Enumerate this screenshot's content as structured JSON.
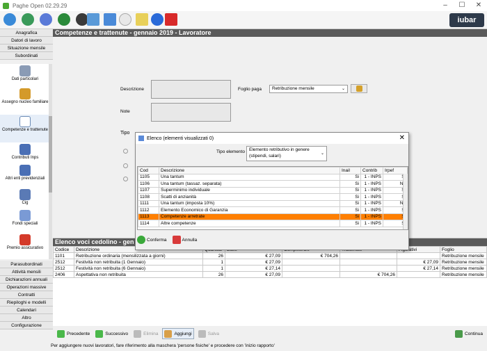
{
  "window": {
    "title": "Paghe Open 02.29.29",
    "logo": "iubar"
  },
  "sidebar": {
    "top_items": [
      "Anagrafica",
      "Datori di lavoro",
      "Situazione mensile",
      "Subordinati"
    ],
    "sub_items": [
      {
        "label": "Dati particolari",
        "icon": "calculator-icon",
        "color": "#8a9bb5"
      },
      {
        "label": "Assegno nucleo familiare",
        "icon": "family-icon",
        "color": "#d49a2a"
      },
      {
        "label": "Competenze e trattenute",
        "icon": "document-icon",
        "color": "#ffffff"
      },
      {
        "label": "Contributi Inps",
        "icon": "percent-icon",
        "color": "#4a6fb5"
      },
      {
        "label": "Altri enti previdenziali",
        "icon": "percent-icon",
        "color": "#4a6fb5"
      },
      {
        "label": "Cig",
        "icon": "factory-icon",
        "color": "#5a7ab5"
      },
      {
        "label": "Fondi speciali",
        "icon": "document-list-icon",
        "color": "#7a9ad5"
      },
      {
        "label": "Premio assicurativo",
        "icon": "ribbon-icon",
        "color": "#d43a2a"
      }
    ],
    "bottom_items": [
      "Parasubordinati",
      "Attività mensili",
      "Dichiarazioni annuali",
      "Operazioni massive",
      "Contratti",
      "Riepiloghi e modelli",
      "Calendari",
      "Altro",
      "Configurazione"
    ]
  },
  "header": {
    "title": "Competenze e trattenute - gennaio 2019 - Lavoratore"
  },
  "form": {
    "descrizione_label": "Descrizione",
    "note_label": "Note",
    "tipo_label": "Tipo",
    "foglio_paga_label": "Foglio paga",
    "foglio_paga_value": "Retribuzione mensile"
  },
  "voci": {
    "header": "Elenco voci cedolino - gen",
    "columns": [
      "Codice",
      "Descrizione",
      "Quantità",
      "Base",
      "Competenze",
      "Trattenute",
      "Figurativi",
      "Foglio"
    ],
    "rows": [
      [
        "1101",
        "Retribuzione ordinaria (mensilizzata a giorni)",
        "26",
        "€ 27,09",
        "€ 704,26",
        "",
        "",
        "Retribuzione mensile"
      ],
      [
        "2512",
        "Festività non retribuita (1 Gennaio)",
        "1",
        "€ 27,09",
        "",
        "",
        "€ 27,09",
        "Retribuzione mensile"
      ],
      [
        "2512",
        "Festività non retribuita (6 Gennaio)",
        "1",
        "€ 27,14",
        "",
        "",
        "€ 27,14",
        "Retribuzione mensile"
      ],
      [
        "2406",
        "Aspettativa non retribuita",
        "26",
        "€ 27,09",
        "",
        "€ 704,26",
        "",
        "Retribuzione mensile"
      ]
    ]
  },
  "footer": {
    "precedente": "Precedente",
    "successivo": "Successivo",
    "elimina": "Elimina",
    "aggiungi": "Aggiungi",
    "salva": "Salva",
    "continua": "Continua"
  },
  "status": "Per aggiungere nuovi lavoratori, fare riferimento alla maschera 'persone fisiche' e procedere con 'inizio rapporto'",
  "dialog": {
    "title": "Elenco (elementi visualizzati 0)",
    "tipo_elemento_label": "Tipo elemento",
    "tipo_elemento_value": "Elemento retributivo in genere (stipendi, salari)",
    "columns": [
      "Cod",
      "Descrizione",
      "Inail",
      "Contrib",
      "Irpef"
    ],
    "rows": [
      [
        "1105",
        "Una tantum",
        "Si",
        "1 - INPS",
        "Si"
      ],
      [
        "1106",
        "Una tantum (tassaz. separata)",
        "Si",
        "1 - INPS",
        "No"
      ],
      [
        "1107",
        "Superminimo individuale",
        "Si",
        "1 - INPS",
        "Si"
      ],
      [
        "1108",
        "Scatti di anzianità",
        "Si",
        "1 - INPS",
        "Si"
      ],
      [
        "1111",
        "Una tantum (imposta 10%)",
        "Si",
        "1 - INPS",
        "No"
      ],
      [
        "1112",
        "Elemento Economico di Garanzia",
        "Si",
        "1 - INPS",
        "Si"
      ],
      [
        "1113",
        "Competenze arretrate",
        "Si",
        "1 - INPS",
        "Si"
      ],
      [
        "1114",
        "Altre competenze",
        "Si",
        "1 - INPS",
        "Si"
      ]
    ],
    "selected_index": 6,
    "conferma": "Conferma",
    "annulla": "Annulla"
  }
}
